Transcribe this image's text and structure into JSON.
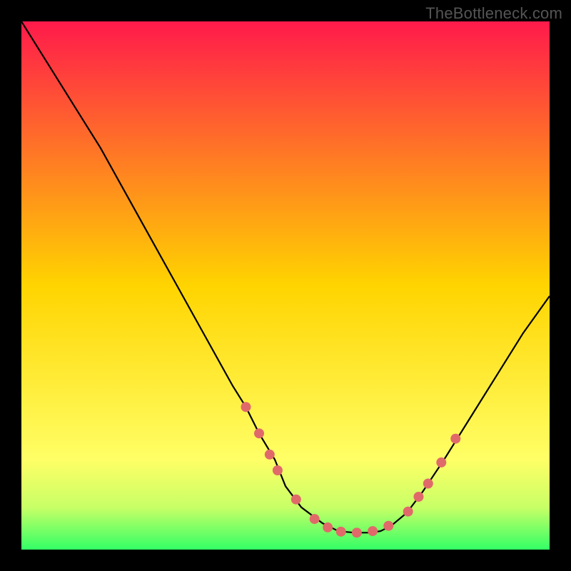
{
  "watermark": "TheBottleneck.com",
  "chart_data": {
    "type": "line",
    "title": "",
    "xlabel": "",
    "ylabel": "",
    "xlim": [
      0,
      1
    ],
    "ylim": [
      0,
      1
    ],
    "background_gradient": {
      "stops": [
        {
          "offset": 0.0,
          "color": "#ff1a4b"
        },
        {
          "offset": 0.5,
          "color": "#ffd400"
        },
        {
          "offset": 0.83,
          "color": "#ffff66"
        },
        {
          "offset": 0.92,
          "color": "#c8ff66"
        },
        {
          "offset": 1.0,
          "color": "#33ff66"
        }
      ]
    },
    "series": [
      {
        "name": "bottleneck-curve",
        "color": "#000000",
        "x": [
          0.0,
          0.05,
          0.1,
          0.15,
          0.2,
          0.25,
          0.3,
          0.35,
          0.4,
          0.425,
          0.45,
          0.48,
          0.5,
          0.53,
          0.57,
          0.6,
          0.63,
          0.66,
          0.68,
          0.7,
          0.73,
          0.76,
          0.8,
          0.85,
          0.9,
          0.95,
          1.0
        ],
        "y": [
          1.0,
          0.92,
          0.84,
          0.76,
          0.67,
          0.58,
          0.49,
          0.4,
          0.31,
          0.27,
          0.22,
          0.17,
          0.12,
          0.08,
          0.05,
          0.035,
          0.032,
          0.032,
          0.035,
          0.045,
          0.07,
          0.11,
          0.17,
          0.25,
          0.33,
          0.41,
          0.48
        ]
      }
    ],
    "scatter": {
      "name": "highlight-dots",
      "color": "#e06a6a",
      "radius": 7,
      "points": [
        {
          "x": 0.425,
          "y": 0.27
        },
        {
          "x": 0.45,
          "y": 0.22
        },
        {
          "x": 0.47,
          "y": 0.18
        },
        {
          "x": 0.485,
          "y": 0.15
        },
        {
          "x": 0.52,
          "y": 0.095
        },
        {
          "x": 0.555,
          "y": 0.058
        },
        {
          "x": 0.58,
          "y": 0.042
        },
        {
          "x": 0.605,
          "y": 0.034
        },
        {
          "x": 0.635,
          "y": 0.032
        },
        {
          "x": 0.665,
          "y": 0.035
        },
        {
          "x": 0.695,
          "y": 0.045
        },
        {
          "x": 0.732,
          "y": 0.072
        },
        {
          "x": 0.752,
          "y": 0.1
        },
        {
          "x": 0.77,
          "y": 0.125
        },
        {
          "x": 0.795,
          "y": 0.165
        },
        {
          "x": 0.822,
          "y": 0.21
        }
      ]
    }
  }
}
